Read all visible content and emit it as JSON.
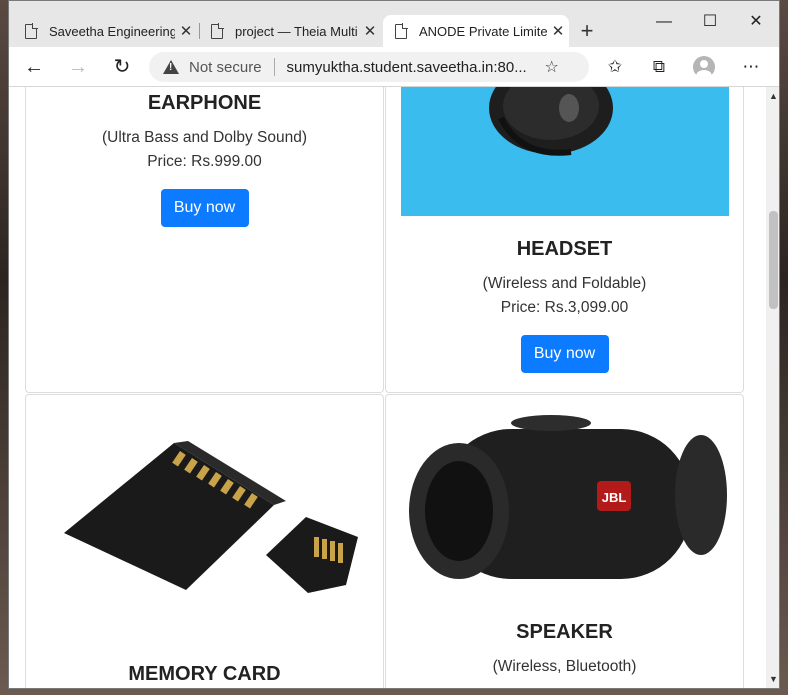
{
  "browser": {
    "tabs": [
      {
        "title": "Saveetha Engineering",
        "active": false
      },
      {
        "title": "project — Theia Multi",
        "active": false
      },
      {
        "title": "ANODE Private Limitec",
        "active": true
      }
    ],
    "new_tab_label": "+",
    "window_controls": {
      "minimize": "—",
      "maximize": "☐",
      "close": "✕"
    },
    "security_label": "Not secure",
    "url": "sumyuktha.student.saveetha.in:80..."
  },
  "products": [
    {
      "name": "EARPHONE",
      "desc": "(Ultra Bass and Dolby Sound)",
      "price": "Price: Rs.999.00",
      "button": "Buy now"
    },
    {
      "name": "HEADSET",
      "desc": "(Wireless and Foldable)",
      "price": "Price: Rs.3,099.00",
      "button": "Buy now"
    },
    {
      "name": "MEMORY CARD"
    },
    {
      "name": "SPEAKER",
      "desc": "(Wireless, Bluetooth)"
    }
  ],
  "speaker_brand": "JBL",
  "colors": {
    "button": "#0d7bff",
    "headset_bg": "#3bbcee"
  }
}
